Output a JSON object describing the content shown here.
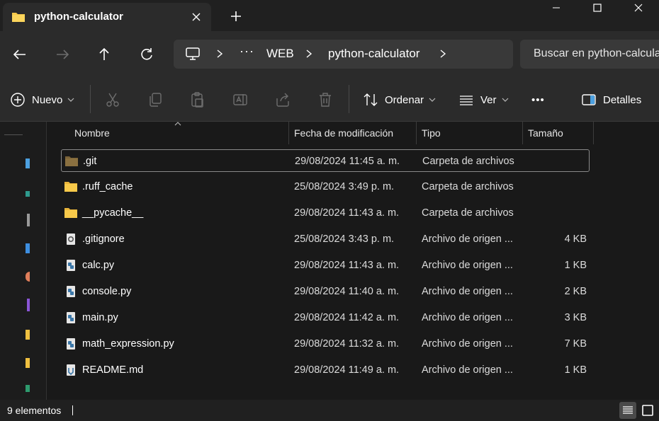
{
  "window": {
    "tab_title": "python-calculator",
    "new_tab_icon": "plus-icon",
    "controls": [
      "minimize-icon",
      "maximize-icon",
      "close-icon"
    ]
  },
  "nav": {
    "back_icon": "arrow-left-icon",
    "forward_icon": "arrow-right-icon",
    "up_icon": "arrow-up-icon",
    "refresh_icon": "refresh-icon",
    "address": {
      "root_icon": "computer-icon",
      "overflow": "···",
      "crumbs": [
        "WEB",
        "python-calculator"
      ]
    },
    "search_placeholder": "Buscar en python-calculator"
  },
  "commands": {
    "new_label": "Nuevo",
    "sort_label": "Ordenar",
    "view_label": "Ver",
    "more_label": "•••",
    "details_label": "Detalles",
    "icons": [
      "cut-icon",
      "copy-icon",
      "paste-icon",
      "rename-icon",
      "share-icon",
      "delete-icon"
    ]
  },
  "columns": {
    "name": "Nombre",
    "date": "Fecha de modificación",
    "type": "Tipo",
    "size": "Tamaño"
  },
  "files": [
    {
      "name": ".git",
      "date": "29/08/2024 11:45 a. m.",
      "type": "Carpeta de archivos",
      "size": "",
      "icon": "folder-dark-icon"
    },
    {
      "name": ".ruff_cache",
      "date": "25/08/2024 3:49 p. m.",
      "type": "Carpeta de archivos",
      "size": "",
      "icon": "folder-icon"
    },
    {
      "name": "__pycache__",
      "date": "29/08/2024 11:43 a. m.",
      "type": "Carpeta de archivos",
      "size": "",
      "icon": "folder-icon"
    },
    {
      "name": ".gitignore",
      "date": "25/08/2024 3:43 p. m.",
      "type": "Archivo de origen ...",
      "size": "4 KB",
      "icon": "settings-file-icon"
    },
    {
      "name": "calc.py",
      "date": "29/08/2024 11:43 a. m.",
      "type": "Archivo de origen ...",
      "size": "1 KB",
      "icon": "python-file-icon"
    },
    {
      "name": "console.py",
      "date": "29/08/2024 11:40 a. m.",
      "type": "Archivo de origen ...",
      "size": "2 KB",
      "icon": "python-file-icon"
    },
    {
      "name": "main.py",
      "date": "29/08/2024 11:42 a. m.",
      "type": "Archivo de origen ...",
      "size": "3 KB",
      "icon": "python-file-icon"
    },
    {
      "name": "math_expression.py",
      "date": "29/08/2024 11:32 a. m.",
      "type": "Archivo de origen ...",
      "size": "7 KB",
      "icon": "python-file-icon"
    },
    {
      "name": "README.md",
      "date": "29/08/2024 11:49 a. m.",
      "type": "Archivo de origen ...",
      "size": "1 KB",
      "icon": "markdown-file-icon"
    }
  ],
  "status": {
    "count": "9 elementos"
  },
  "colors": {
    "folder": "#f7c94a",
    "folder_dark": "#8a7040",
    "accent": "#4ca0e0"
  }
}
